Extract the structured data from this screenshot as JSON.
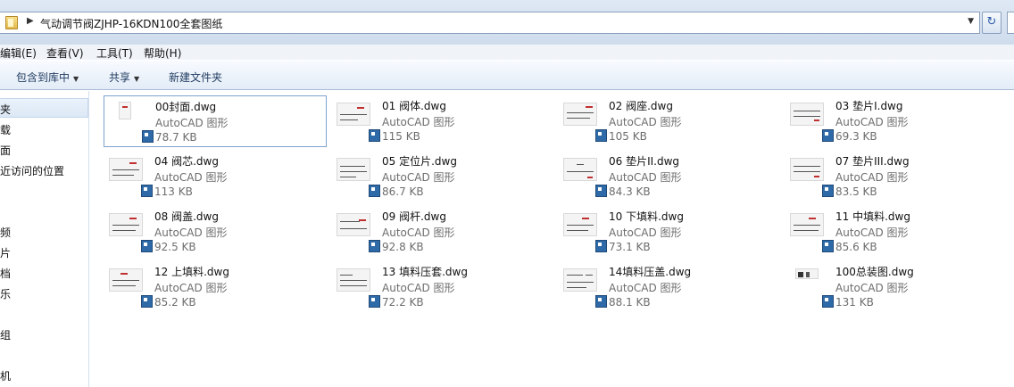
{
  "address": {
    "path": "气动调节阀ZJHP-16KDN100全套图纸"
  },
  "menu": [
    {
      "label": "编辑(E)"
    },
    {
      "label": "查看(V)"
    },
    {
      "label": "工具(T)"
    },
    {
      "label": "帮助(H)"
    }
  ],
  "toolbar": {
    "include_library": "包含到库中",
    "share": "共享",
    "new_folder": "新建文件夹"
  },
  "nav": [
    {
      "label": "夹"
    },
    {
      "label": "载"
    },
    {
      "label": "面"
    },
    {
      "label": "近访问的位置"
    },
    {
      "label": "频"
    },
    {
      "label": "片"
    },
    {
      "label": "档"
    },
    {
      "label": "乐"
    },
    {
      "label": "组"
    },
    {
      "label": "机"
    }
  ],
  "files": [
    {
      "name": "00封面.dwg",
      "type": "AutoCAD 图形",
      "size": "78.7 KB"
    },
    {
      "name": "01 阀体.dwg",
      "type": "AutoCAD 图形",
      "size": "115 KB"
    },
    {
      "name": "02 阀座.dwg",
      "type": "AutoCAD 图形",
      "size": "105 KB"
    },
    {
      "name": "03 垫片I.dwg",
      "type": "AutoCAD 图形",
      "size": "69.3 KB"
    },
    {
      "name": "04 阀芯.dwg",
      "type": "AutoCAD 图形",
      "size": "113 KB"
    },
    {
      "name": "05 定位片.dwg",
      "type": "AutoCAD 图形",
      "size": "86.7 KB"
    },
    {
      "name": "06 垫片II.dwg",
      "type": "AutoCAD 图形",
      "size": "84.3 KB"
    },
    {
      "name": "07 垫片III.dwg",
      "type": "AutoCAD 图形",
      "size": "83.5 KB"
    },
    {
      "name": "08 阀盖.dwg",
      "type": "AutoCAD 图形",
      "size": "92.5 KB"
    },
    {
      "name": "09 阀杆.dwg",
      "type": "AutoCAD 图形",
      "size": "92.8 KB"
    },
    {
      "name": "10 下填料.dwg",
      "type": "AutoCAD 图形",
      "size": "73.1 KB"
    },
    {
      "name": "11 中填料.dwg",
      "type": "AutoCAD 图形",
      "size": "85.6 KB"
    },
    {
      "name": "12 上填料.dwg",
      "type": "AutoCAD 图形",
      "size": "85.2 KB"
    },
    {
      "name": "13 填料压套.dwg",
      "type": "AutoCAD 图形",
      "size": "72.2 KB"
    },
    {
      "name": "14填料压盖.dwg",
      "type": "AutoCAD 图形",
      "size": "88.1 KB"
    },
    {
      "name": "100总装图.dwg",
      "type": "AutoCAD 图形",
      "size": "131 KB"
    }
  ]
}
